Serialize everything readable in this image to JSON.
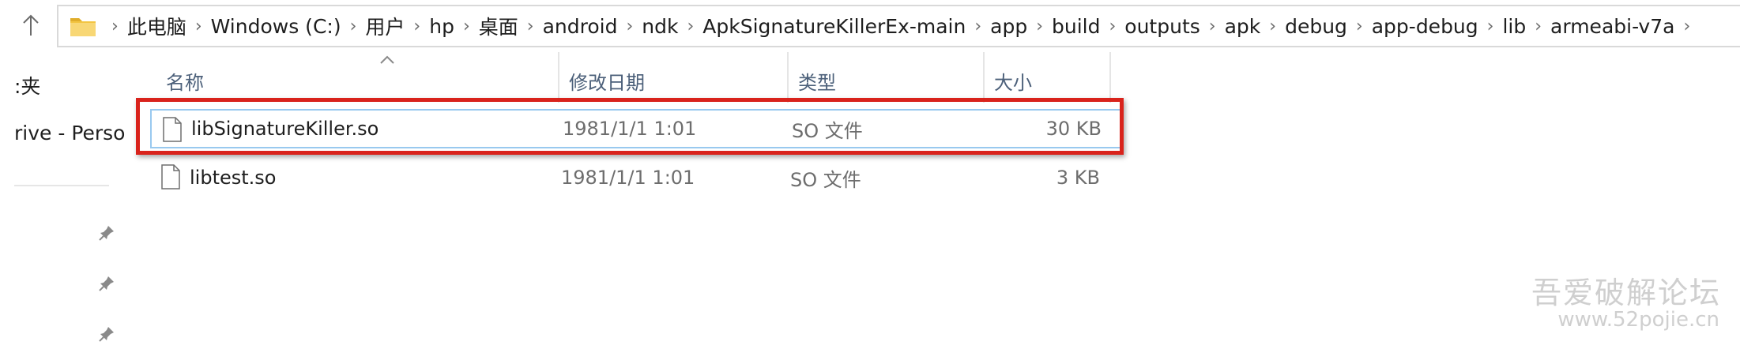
{
  "address_bar": {
    "up_icon": "up-arrow-icon",
    "folder_icon": "folder-icon",
    "crumbs": [
      "此电脑",
      "Windows (C:)",
      "用户",
      "hp",
      "桌面",
      "android",
      "ndk",
      "ApkSignatureKillerEx-main",
      "app",
      "build",
      "outputs",
      "apk",
      "debug",
      "app-debug",
      "lib",
      "armeabi-v7a"
    ]
  },
  "nav": {
    "items": [
      ":夹",
      "rive - Perso"
    ],
    "pin_icon": "pin-icon"
  },
  "columns": {
    "name": "名称",
    "date": "修改日期",
    "type": "类型",
    "size": "大小"
  },
  "files": [
    {
      "name": "libSignatureKiller.so",
      "date": "1981/1/1 1:01",
      "type": "SO 文件",
      "size": "30 KB",
      "selected": true
    },
    {
      "name": "libtest.so",
      "date": "1981/1/1 1:01",
      "type": "SO 文件",
      "size": "3 KB",
      "selected": false
    }
  ],
  "annotation": {
    "highlight_color": "#d9231c"
  },
  "watermark": {
    "line1": "吾爱破解论坛",
    "line2": "www.52pojie.cn"
  }
}
